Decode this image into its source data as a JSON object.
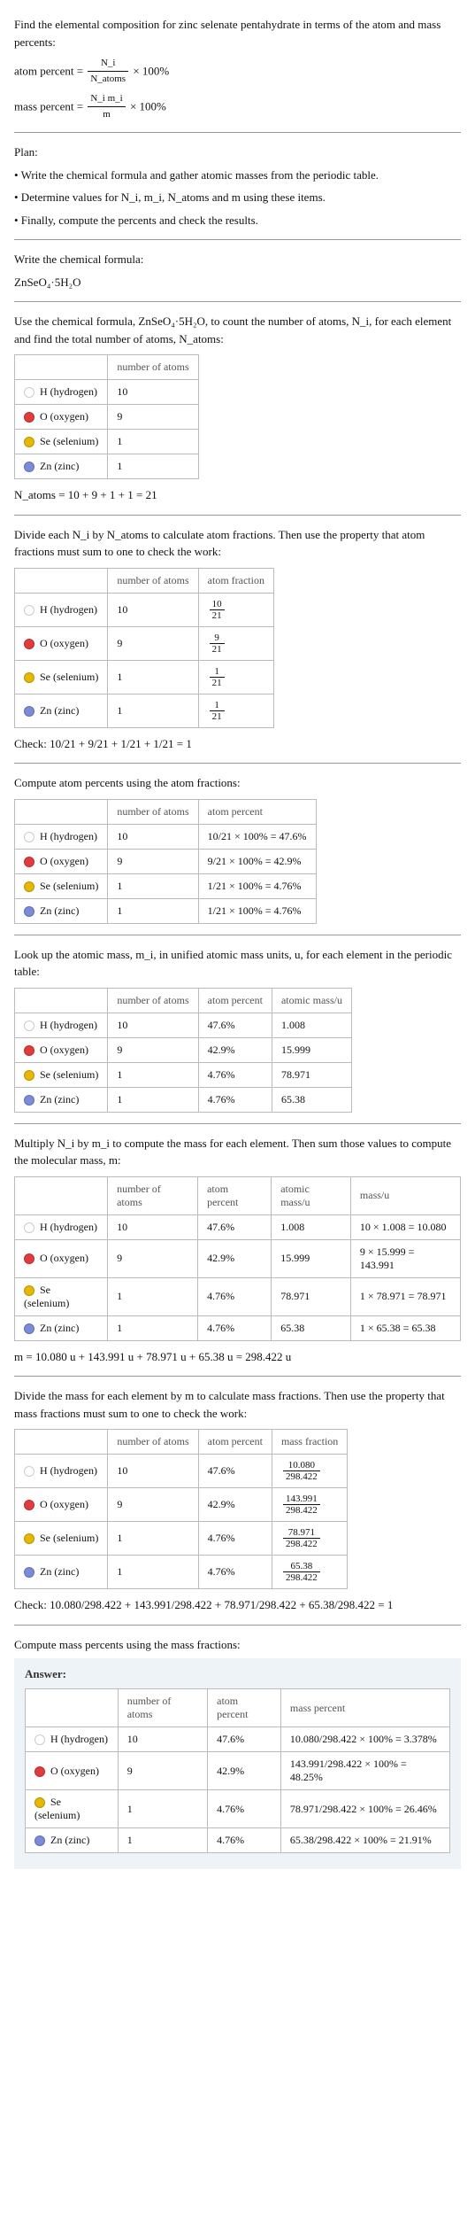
{
  "intro": {
    "line1": "Find the elemental composition for zinc selenate pentahydrate in terms of the atom and mass percents:",
    "atom_percent_lhs": "atom percent =",
    "atom_percent_num": "N_i",
    "atom_percent_den": "N_atoms",
    "times100": "× 100%",
    "mass_percent_lhs": "mass percent =",
    "mass_percent_num": "N_i m_i",
    "mass_percent_den": "m"
  },
  "plan": {
    "heading": "Plan:",
    "b1": "• Write the chemical formula and gather atomic masses from the periodic table.",
    "b2": "• Determine values for N_i, m_i, N_atoms and m using these items.",
    "b3": "• Finally, compute the percents and check the results."
  },
  "formula": {
    "label": "Write the chemical formula:",
    "value": "ZnSeO₄·5H₂O"
  },
  "count": {
    "text": "Use the chemical formula, ZnSeO₄·5H₂O, to count the number of atoms, N_i, for each element and find the total number of atoms, N_atoms:",
    "header_atoms": "number of atoms",
    "total": "N_atoms = 10 + 9 + 1 + 1 = 21"
  },
  "elements": [
    {
      "name": "H (hydrogen)",
      "color": "#ffffff",
      "atoms": "10",
      "frac_num": "10",
      "frac_den": "21",
      "pct": "47.6%",
      "mass_u": "1.008",
      "mass_calc": "10 × 1.008 = 10.080",
      "mf_num": "10.080",
      "mf_den": "298.422",
      "ans_pct": "10.080/298.422 × 100% = 3.378%"
    },
    {
      "name": "O (oxygen)",
      "color": "#e03c3c",
      "atoms": "9",
      "frac_num": "9",
      "frac_den": "21",
      "pct": "42.9%",
      "mass_u": "15.999",
      "mass_calc": "9 × 15.999 = 143.991",
      "mf_num": "143.991",
      "mf_den": "298.422",
      "ans_pct": "143.991/298.422 × 100% = 48.25%"
    },
    {
      "name": "Se (selenium)",
      "color": "#e6b800",
      "atoms": "1",
      "frac_num": "1",
      "frac_den": "21",
      "pct": "4.76%",
      "mass_u": "78.971",
      "mass_calc": "1 × 78.971 = 78.971",
      "mf_num": "78.971",
      "mf_den": "298.422",
      "ans_pct": "78.971/298.422 × 100% = 26.46%"
    },
    {
      "name": "Zn (zinc)",
      "color": "#7a8bd9",
      "atoms": "1",
      "frac_num": "1",
      "frac_den": "21",
      "pct": "4.76%",
      "mass_u": "65.38",
      "mass_calc": "1 × 65.38 = 65.38",
      "mf_num": "65.38",
      "mf_den": "298.422",
      "ans_pct": "65.38/298.422 × 100% = 21.91%"
    }
  ],
  "fractions": {
    "text": "Divide each N_i by N_atoms to calculate atom fractions. Then use the property that atom fractions must sum to one to check the work:",
    "header_frac": "atom fraction",
    "check": "Check: 10/21 + 9/21 + 1/21 + 1/21 = 1"
  },
  "percents": {
    "text": "Compute atom percents using the atom fractions:",
    "header_pct": "atom percent",
    "rows": [
      "10/21 × 100% = 47.6%",
      "9/21 × 100% = 42.9%",
      "1/21 × 100% = 4.76%",
      "1/21 × 100% = 4.76%"
    ]
  },
  "masses": {
    "text": "Look up the atomic mass, m_i, in unified atomic mass units, u, for each element in the periodic table:",
    "header_massu": "atomic mass/u"
  },
  "molmass": {
    "text": "Multiply N_i by m_i to compute the mass for each element. Then sum those values to compute the molecular mass, m:",
    "header_mass": "mass/u",
    "total": "m = 10.080 u + 143.991 u + 78.971 u + 65.38 u = 298.422 u"
  },
  "massfrac": {
    "text": "Divide the mass for each element by m to calculate mass fractions. Then use the property that mass fractions must sum to one to check the work:",
    "header_mf": "mass fraction",
    "check": "Check: 10.080/298.422 + 143.991/298.422 + 78.971/298.422 + 65.38/298.422 = 1"
  },
  "masspct": {
    "text": "Compute mass percents using the mass fractions:"
  },
  "answer": {
    "label": "Answer:",
    "header_mp": "mass percent"
  }
}
